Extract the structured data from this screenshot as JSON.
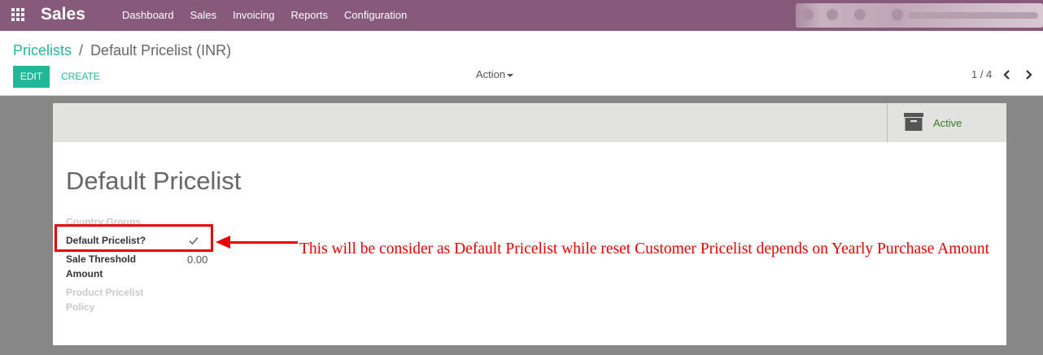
{
  "navbar": {
    "app_name": "Sales",
    "menu": [
      "Dashboard",
      "Sales",
      "Invoicing",
      "Reports",
      "Configuration"
    ]
  },
  "breadcrumb": {
    "parent": "Pricelists",
    "separator": "/",
    "current": "Default Pricelist (INR)"
  },
  "buttons": {
    "edit": "EDIT",
    "create": "CREATE",
    "action": "Action"
  },
  "pager": {
    "value": "1 / 4"
  },
  "status": {
    "active_label": "Active"
  },
  "record": {
    "title": "Default Pricelist",
    "fields": {
      "country_groups": "Country Groups",
      "default_pricelist": "Default Pricelist?",
      "default_pricelist_checked": true,
      "sale_threshold_line1": "Sale Threshold",
      "sale_threshold_line2": "Amount",
      "sale_threshold_value": "0.00",
      "product_policy_line1": "Product Pricelist",
      "product_policy_line2": "Policy"
    }
  },
  "annotation": {
    "text": "This will be consider as Default Pricelist while reset Customer Pricelist depends on Yearly Purchase Amount",
    "color": "#e80000"
  },
  "colors": {
    "navbar": "#875a7b",
    "accent": "#21b799",
    "active_green": "#3a7a27"
  }
}
